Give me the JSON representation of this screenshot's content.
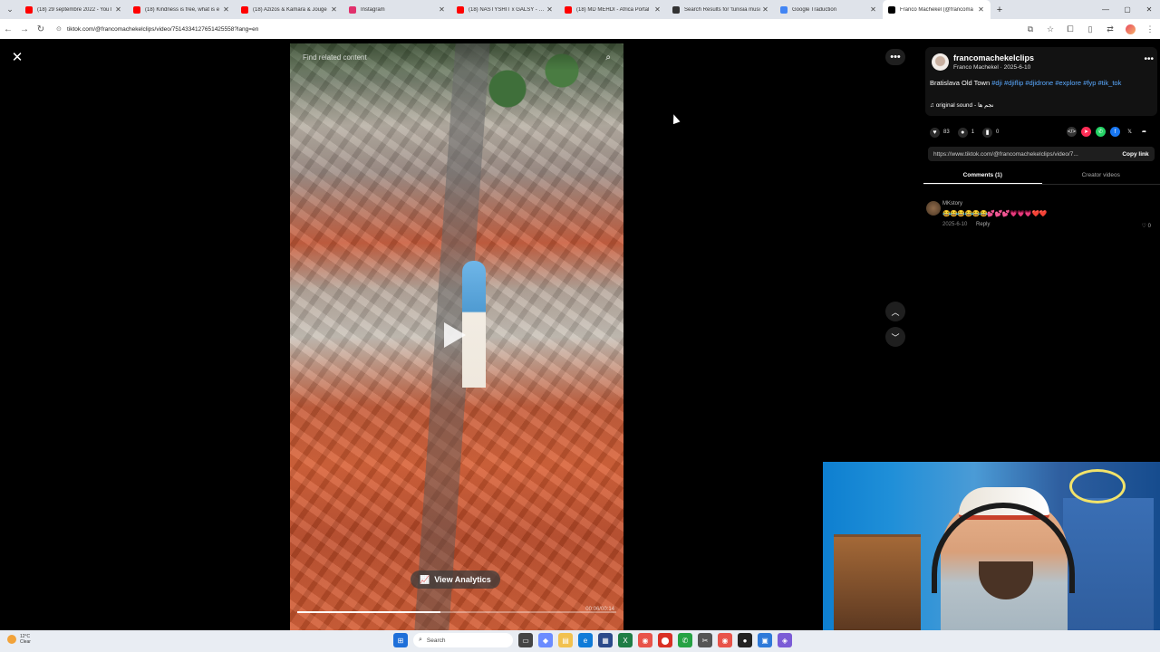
{
  "browser": {
    "tabs": [
      {
        "title": "(18) 29 septembre 2022 - YouT",
        "color": "#ff0000"
      },
      {
        "title": "(18) Kindness is free, what is e",
        "color": "#ff0000"
      },
      {
        "title": "(18) Azizos & Kamara & Jouge",
        "color": "#ff0000"
      },
      {
        "title": "Instagram",
        "color": "#e1306c"
      },
      {
        "title": "(18) NASTYSHIT x GALSY - No",
        "color": "#ff0000"
      },
      {
        "title": "(18) MD MEHDI - Africa Portal",
        "color": "#ff0000"
      },
      {
        "title": "Search Results for 'tunisia musi",
        "color": "#333333"
      },
      {
        "title": "Google Traduction",
        "color": "#4285f4"
      },
      {
        "title": "Franco Machekel (@francoma",
        "color": "#000000"
      }
    ],
    "url": "tiktok.com/@francomachekelclips/video/7514334127651425558?lang=en"
  },
  "video": {
    "search_placeholder": "Find related content",
    "analytics_label": "View Analytics",
    "progress": 0.45,
    "timecode": "00:06/00:14"
  },
  "post": {
    "username": "francomachekelclips",
    "display_line": "Franco Machekel · 2025-6-10",
    "caption_text": "Bratislava Old Town ",
    "hashtags": [
      "#dji",
      "#djiflip",
      "#djidrone",
      "#explore",
      "#fyp",
      "#tik_tok"
    ],
    "sound": "original sound - نجم ها",
    "likes": "83",
    "comments": "1",
    "saves": "0",
    "link": "https://www.tiktok.com/@francomachekelclips/video/7...",
    "copy_link": "Copy link"
  },
  "panel_tabs": {
    "comments": "Comments (1)",
    "creator_videos": "Creator videos"
  },
  "comment": {
    "name": "MKstory",
    "text": "😂😂😂😂😂😂💕💕💕💗💗💗❤️❤️",
    "date": "2025-6-10",
    "reply": "Reply",
    "likes": "0"
  },
  "taskbar": {
    "temp": "12°C",
    "weather": "Clear",
    "search": "Search"
  }
}
